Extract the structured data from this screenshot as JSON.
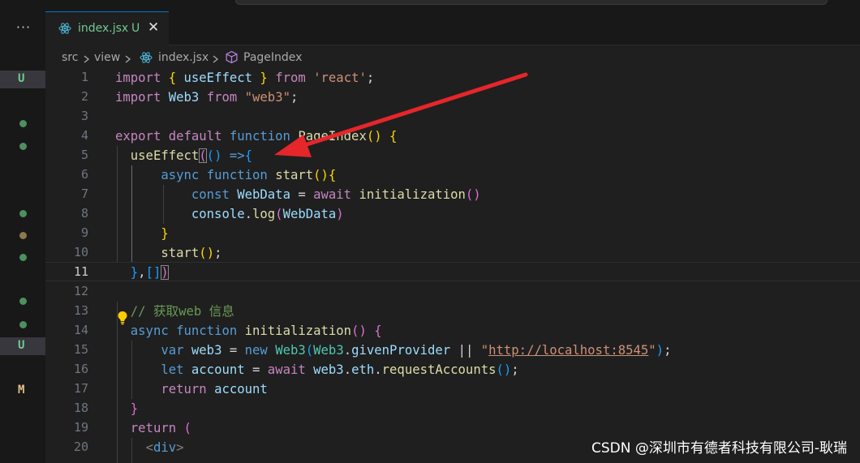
{
  "tab": {
    "filename": "index.jsx",
    "status": "U",
    "close": "✕"
  },
  "breadcrumb": {
    "items": [
      "src",
      "view",
      "index.jsx",
      "PageIndex"
    ]
  },
  "sidebar": {
    "menu": "···",
    "markers": [
      "U",
      "●",
      "●",
      "●",
      "●",
      "●",
      "●",
      "●",
      "U",
      "M"
    ],
    "colors": {
      "untracked": "#73c991",
      "modified": "#e2c08d",
      "dot_green": "#4e8f60",
      "dot_amber": "#8a7a4e"
    }
  },
  "editor": {
    "lines": [
      {
        "n": "1"
      },
      {
        "n": "2"
      },
      {
        "n": "3"
      },
      {
        "n": "4"
      },
      {
        "n": "5"
      },
      {
        "n": "6"
      },
      {
        "n": "7"
      },
      {
        "n": "8"
      },
      {
        "n": "9"
      },
      {
        "n": "10"
      },
      {
        "n": "11"
      },
      {
        "n": "12"
      },
      {
        "n": "13"
      },
      {
        "n": "14"
      },
      {
        "n": "15"
      },
      {
        "n": "16"
      },
      {
        "n": "17"
      },
      {
        "n": "18"
      },
      {
        "n": "19"
      },
      {
        "n": "20"
      }
    ],
    "current_line": "11"
  },
  "code": {
    "l1": [
      "import",
      "{",
      "useEffect",
      "}",
      "from",
      "'react'",
      ";"
    ],
    "l2": [
      "import",
      "Web3",
      "from",
      "\"web3\"",
      ";"
    ],
    "l4": [
      "export",
      "default",
      "function",
      "PageIndex",
      "(",
      ")",
      "{"
    ],
    "l5": [
      "useEffect",
      "(",
      "(",
      ")",
      "=>",
      "{"
    ],
    "l6": [
      "async",
      "function",
      "start",
      "(",
      ")",
      "{"
    ],
    "l7": [
      "const",
      "WebData",
      "=",
      "await",
      "initialization",
      "(",
      ")"
    ],
    "l8": [
      "console",
      ".",
      "log",
      "(",
      "WebData",
      ")"
    ],
    "l9": [
      "}"
    ],
    "l10": [
      "start",
      "(",
      ")",
      ";"
    ],
    "l11": [
      "}",
      ",",
      "[",
      "]",
      ")"
    ],
    "l13": [
      "// 获取web 信息"
    ],
    "l14": [
      "async",
      "function",
      "initialization",
      "(",
      ")",
      "{"
    ],
    "l15": [
      "var",
      "web3",
      "=",
      "new",
      "Web3",
      "(",
      "Web3",
      ".",
      "givenProvider",
      "||",
      "\"",
      "http://localhost:8545",
      "\"",
      ")",
      ";"
    ],
    "l16": [
      "let",
      "account",
      "=",
      "await",
      "web3",
      ".",
      "eth",
      ".",
      "requestAccounts",
      "(",
      ")",
      ";"
    ],
    "l17": [
      "return",
      "account"
    ],
    "l18": [
      "}"
    ],
    "l19": [
      "return",
      "("
    ],
    "l20": [
      "<",
      "div",
      ">"
    ]
  },
  "watermark": "CSDN @深圳市有德者科技有限公司-耿瑞",
  "annotation": {
    "arrow_color": "#e5262b"
  }
}
